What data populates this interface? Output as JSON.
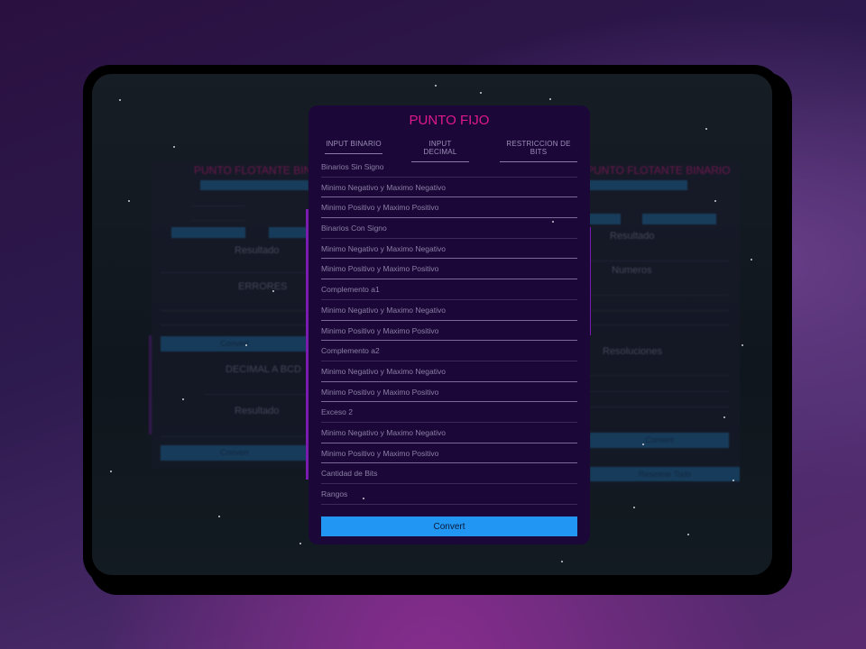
{
  "panel": {
    "title": "PUNTO FIJO",
    "tabs": [
      "INPUT BINARIO",
      "INPUT DECIMAL",
      "RESTRICCION DE BITS"
    ],
    "rows": [
      {
        "label": "Binarios Sin Signo",
        "header": true
      },
      {
        "label": "Minimo Negativo y Maximo Negativo"
      },
      {
        "label": "Minimo Positivo y Maximo Positivo"
      },
      {
        "label": "Binarios Con Signo",
        "header": true
      },
      {
        "label": "Minimo Negativo y Maximo Negativo"
      },
      {
        "label": "Minimo Positivo y Maximo Positivo"
      },
      {
        "label": "Complemento a1",
        "header": true
      },
      {
        "label": "Minimo Negativo y Maximo Negativo"
      },
      {
        "label": "Minimo Positivo y Maximo Positivo"
      },
      {
        "label": "Complemento a2",
        "header": true
      },
      {
        "label": "Minimo Negativo y Maximo Negativo"
      },
      {
        "label": "Minimo Positivo y Maximo Positivo"
      },
      {
        "label": "Exceso 2",
        "header": true
      },
      {
        "label": "Minimo Negativo y Maximo Negativo"
      },
      {
        "label": "Minimo Positivo y Maximo Positivo"
      },
      {
        "label": "Cantidad de Bits",
        "header": true
      },
      {
        "label": "Rangos",
        "header": true
      }
    ],
    "convert": "Convert"
  },
  "left_card": {
    "title": "PUNTO FLOTANTE BINARIO",
    "resultado": "Resultado",
    "errores": "ERRORES",
    "convert": "Convert",
    "bcd_title": "DECIMAL A BCD",
    "bcd_resultado": "Resultado",
    "bcd_convert": "Convert"
  },
  "right_card": {
    "title": "PUNTO FLOTANTE BINARIO",
    "resultado": "Resultado",
    "numeros": "Numeros",
    "resoluciones": "Resoluciones",
    "convert": "Convert",
    "reset": "Resetear Todo"
  }
}
